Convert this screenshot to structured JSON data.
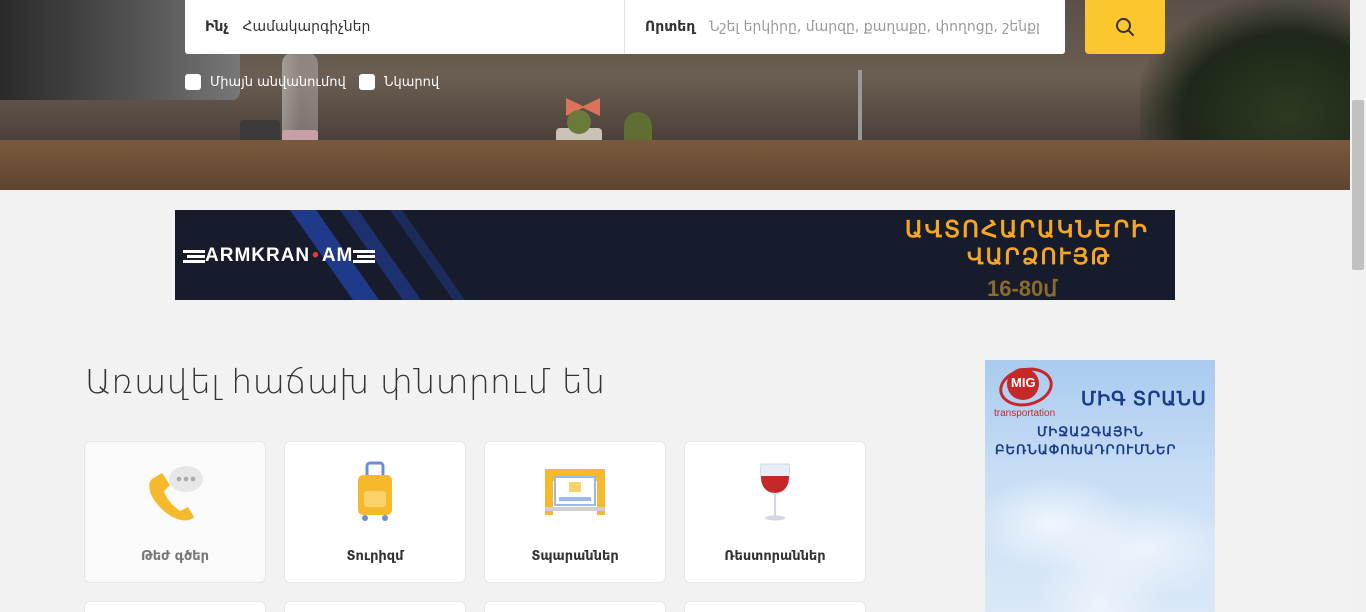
{
  "search": {
    "what_label": "Ինչ",
    "what_value": "Համակարգիչներ",
    "where_label": "Որտեղ",
    "where_placeholder": "Նշել երկիրը, մարզը, քաղաքը, փողոցը, շենքը"
  },
  "filters": {
    "by_name_label": "Միայն անվանումով",
    "with_photo_label": "Նկարով"
  },
  "banner": {
    "logo_left": "ARMKRAN",
    "logo_dot": "•",
    "logo_right": "AM",
    "headline": "ԱՎՏՈՀԱՐԱԿՆԵՐԻ",
    "subline": "ՎԱՐՁՈՒՅԹ",
    "range": "16-80մ"
  },
  "section": {
    "title": "Առավել հաճախ փնտրում են"
  },
  "categories": [
    {
      "label": "Թեժ գծեր",
      "icon": "phone-chat-icon"
    },
    {
      "label": "Տուրիզմ",
      "icon": "suitcase-icon"
    },
    {
      "label": "Տպարաններ",
      "icon": "printer-icon"
    },
    {
      "label": "Ռեստորաններ",
      "icon": "wine-glass-icon"
    }
  ],
  "ad": {
    "logo": "MIG",
    "logo_sub": "transportation",
    "brand": "ՄԻԳ ՏՐԱՆՍ",
    "desc_line1": "ՄԻՋԱԶԳԱՅԻՆ",
    "desc_line2": "ԲԵՌՆԱՓՈԽԱԴՐՈՒՄՆԵՐ"
  },
  "colors": {
    "accent": "#fcc62d",
    "banner_bg": "#161c2c",
    "banner_text": "#f6a623",
    "ad_text": "#1a3a8a",
    "page_bg": "#f2f2f2"
  }
}
